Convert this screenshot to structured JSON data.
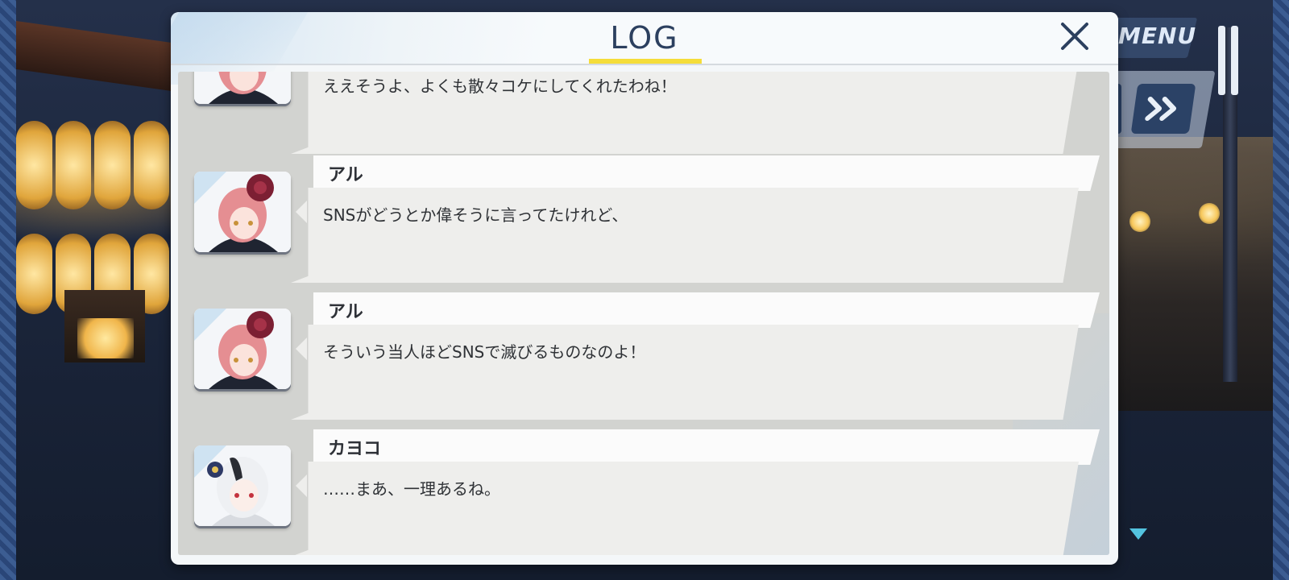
{
  "log": {
    "title": "LOG",
    "entries": [
      {
        "speaker": "",
        "text": "ええそうよ、よくも散々コケにしてくれたわね！",
        "character": "aru"
      },
      {
        "speaker": "アル",
        "text": "SNSがどうとか偉そうに言ってたけれど、",
        "character": "aru"
      },
      {
        "speaker": "アル",
        "text": "そういう当人ほどSNSで滅びるものなのよ！",
        "character": "aru"
      },
      {
        "speaker": "カヨコ",
        "text": "……まあ、一理あるね。",
        "character": "kayoko"
      }
    ]
  },
  "hud": {
    "menu_label": "MENU",
    "pause_icon": "pause-icon",
    "skip_icon": "fast-forward-icon",
    "close_icon": "close-icon",
    "next_icon": "next-triangle-icon"
  },
  "colors": {
    "title_text": "#2c405f",
    "title_underline": "#f5dd3a",
    "hud_button": "#2b4266",
    "next_indicator": "#53c3df"
  }
}
